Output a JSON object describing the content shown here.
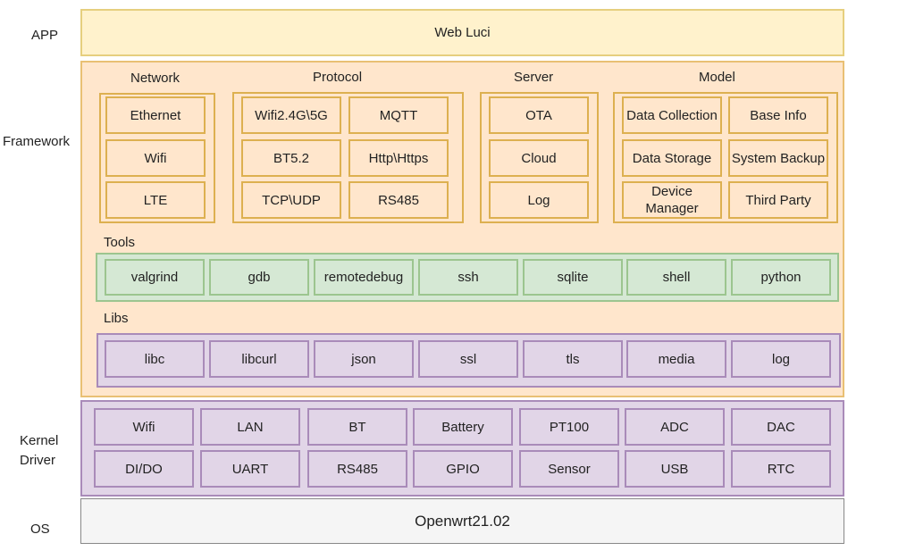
{
  "layers": {
    "app": "APP",
    "framework": "Framework",
    "kernel_line1": "Kernel",
    "kernel_line2": "Driver",
    "os": "OS"
  },
  "app_box": "Web Luci",
  "framework": {
    "network": {
      "title": "Network",
      "items": [
        "Ethernet",
        "Wifi",
        "LTE"
      ]
    },
    "protocol": {
      "title": "Protocol",
      "items": [
        "Wifi2.4G\\5G",
        "MQTT",
        "BT5.2",
        "Http\\Https",
        "TCP\\UDP",
        "RS485"
      ]
    },
    "server": {
      "title": "Server",
      "items": [
        "OTA",
        "Cloud",
        "Log"
      ]
    },
    "model": {
      "title": "Model",
      "items": [
        "Data Collection",
        "Base Info",
        "Data Storage",
        "System Backup",
        "Device Manager",
        "Third Party"
      ]
    },
    "tools": {
      "title": "Tools",
      "items": [
        "valgrind",
        "gdb",
        "remotedebug",
        "ssh",
        "sqlite",
        "shell",
        "python"
      ]
    },
    "libs": {
      "title": "Libs",
      "items": [
        "libc",
        "libcurl",
        "json",
        "ssl",
        "tls",
        "media",
        "log"
      ]
    }
  },
  "kernel": {
    "row1": [
      "Wifi",
      "LAN",
      "BT",
      "Battery",
      "PT100",
      "ADC",
      "DAC"
    ],
    "row2": [
      "DI/DO",
      "UART",
      "RS485",
      "GPIO",
      "Sensor",
      "USB",
      "RTC"
    ]
  },
  "os_box": "Openwrt21.02",
  "colors": {
    "app_fill": "#fff2cc",
    "framework_fill": "#ffe6cc",
    "tools_fill": "#d5e8d4",
    "libs_fill": "#e1d5e7",
    "kernel_fill": "#e1d5e7",
    "os_fill": "#f5f5f5"
  }
}
